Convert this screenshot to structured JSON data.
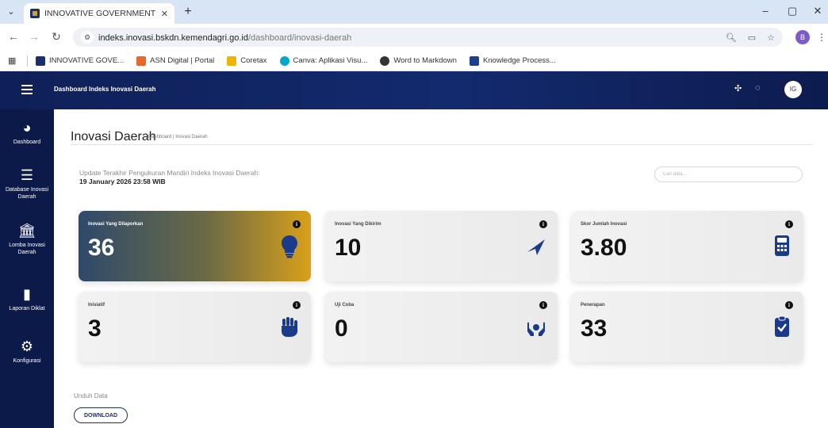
{
  "browser": {
    "tab_title": "INNOVATIVE GOVERNMENT AW",
    "tab_close": "✕",
    "new_tab": "+",
    "window_controls": [
      "–",
      "▢",
      "✕"
    ],
    "url_host": "indeks.inovasi.bskdn.kemendagri.go.id",
    "url_path": "/dashboard/inovasi-daerah",
    "profile_initial": "B",
    "bookmarks": [
      {
        "label": "INNOVATIVE GOVE...",
        "color": "#1a2e6b"
      },
      {
        "label": "ASN Digital | Portal",
        "color": "#e8672c"
      },
      {
        "label": "Coretax",
        "color": "#f0b400"
      },
      {
        "label": "Canva: Aplikasi Visu...",
        "color": "#00a9c9"
      },
      {
        "label": "Word to Markdown",
        "color": "#333333"
      },
      {
        "label": "Knowledge Process...",
        "color": "#1d3f8c"
      }
    ]
  },
  "topbar": {
    "title": "Dashboard Indeks Inovasi Daerah",
    "avatar": "IG"
  },
  "sidebar": {
    "items": [
      {
        "label": "Dashboard",
        "icon": "dashboard-icon"
      },
      {
        "label": "Database Inovasi Daerah",
        "icon": "database-icon"
      },
      {
        "label": "Lomba Inovasi Daerah",
        "icon": "bank-icon"
      },
      {
        "label": "Laporan Diklat",
        "icon": "file-icon"
      },
      {
        "label": "Konfigurasi",
        "icon": "gear-icon"
      }
    ]
  },
  "page": {
    "title": "Inovasi Daerah",
    "breadcrumb": "Dashboard | Inovasi Daerah",
    "update_label": "Update Terakhir Pengukuran Mandiri Indeks Inovasi Daerah:",
    "update_value": "19 January 2026 23:58 WIB",
    "search_placeholder": "Cari data..."
  },
  "cards": [
    {
      "label": "Inovasi Yang Dilaporkan",
      "value": "36",
      "icon": "lightbulb-icon"
    },
    {
      "label": "Inovasi Yang Dikirim",
      "value": "10",
      "icon": "paper-plane-icon"
    },
    {
      "label": "Skor Jumlah Inovasi",
      "value": "3.80",
      "icon": "calculator-icon"
    },
    {
      "label": "Inisiatif",
      "value": "3",
      "icon": "fist-icon"
    },
    {
      "label": "Uji Coba",
      "value": "0",
      "icon": "hands-icon"
    },
    {
      "label": "Penerapan",
      "value": "33",
      "icon": "clipboard-check-icon"
    }
  ],
  "download": {
    "label": "Unduh Data",
    "button": "DOWNLOAD"
  },
  "colors": {
    "topbar": "#132a6e",
    "sidebar": "#0c1a4a",
    "highlight_start": "#2e4a6a",
    "highlight_end": "#d8a01a",
    "icon_blue": "#1a3a8c"
  }
}
